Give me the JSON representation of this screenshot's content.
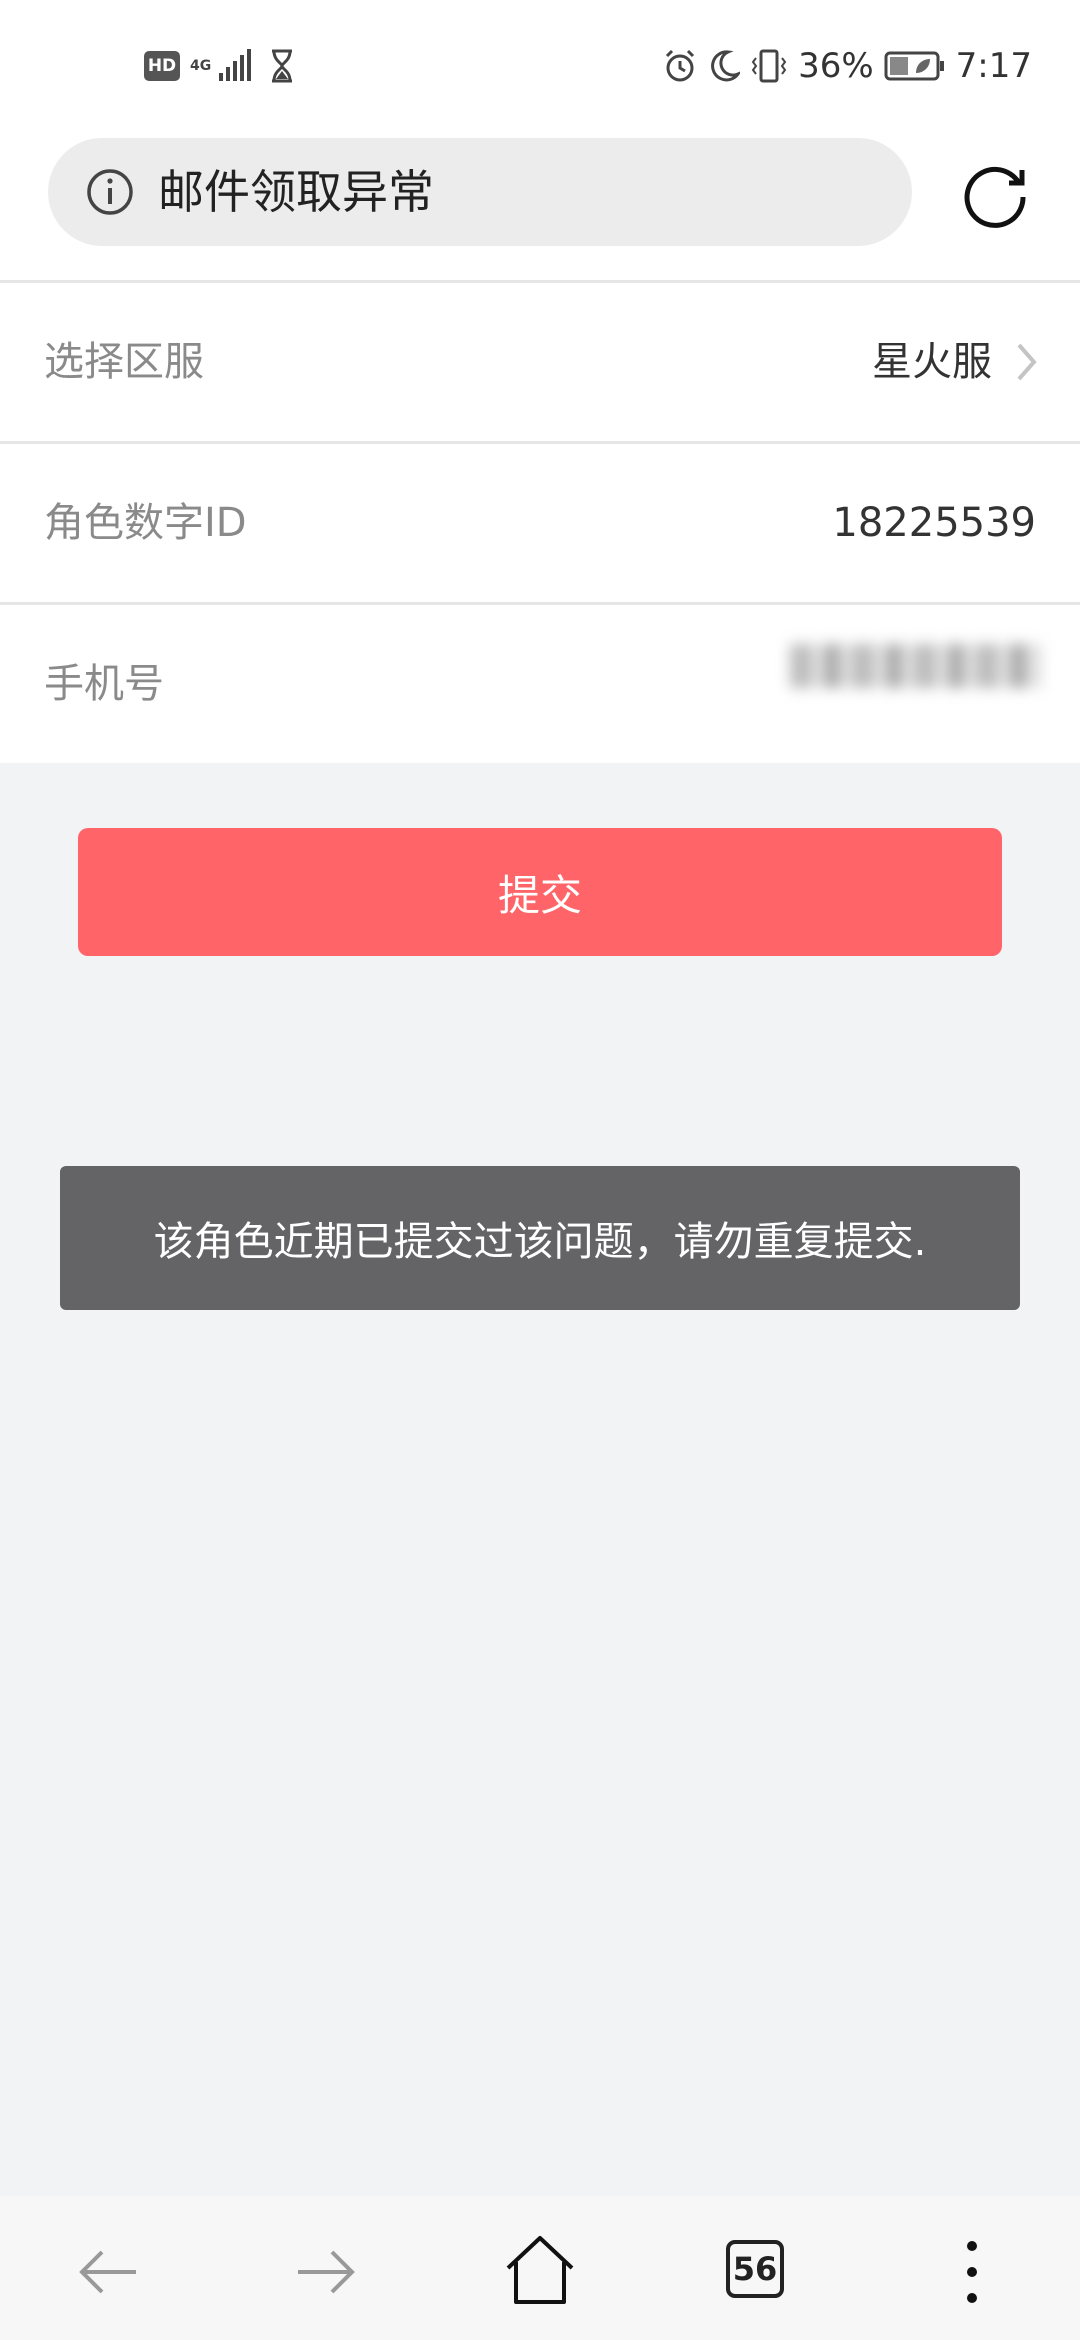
{
  "status_bar": {
    "hd": "HD",
    "network": "4G",
    "battery": "36%",
    "time": "7:17"
  },
  "url_bar": {
    "title": "邮件领取异常"
  },
  "form": {
    "rows": [
      {
        "label": "选择区服",
        "value": "星火服"
      },
      {
        "label": "角色数字ID",
        "value": "18225539"
      },
      {
        "label": "手机号"
      }
    ]
  },
  "submit_label": "提交",
  "toast": "该角色近期已提交过该问题，请勿重复提交.",
  "nav_bar": {
    "tabs_count": "56"
  },
  "icons": {
    "info": "info-icon",
    "reload": "reload-icon",
    "chevron": "chevron-right-icon",
    "back": "back-arrow-icon",
    "forward": "forward-arrow-icon",
    "home": "home-icon",
    "menu": "more-vertical-icon"
  },
  "colors": {
    "submit": "#ff6468",
    "toast": "#646466",
    "background": "#f2f3f5"
  }
}
